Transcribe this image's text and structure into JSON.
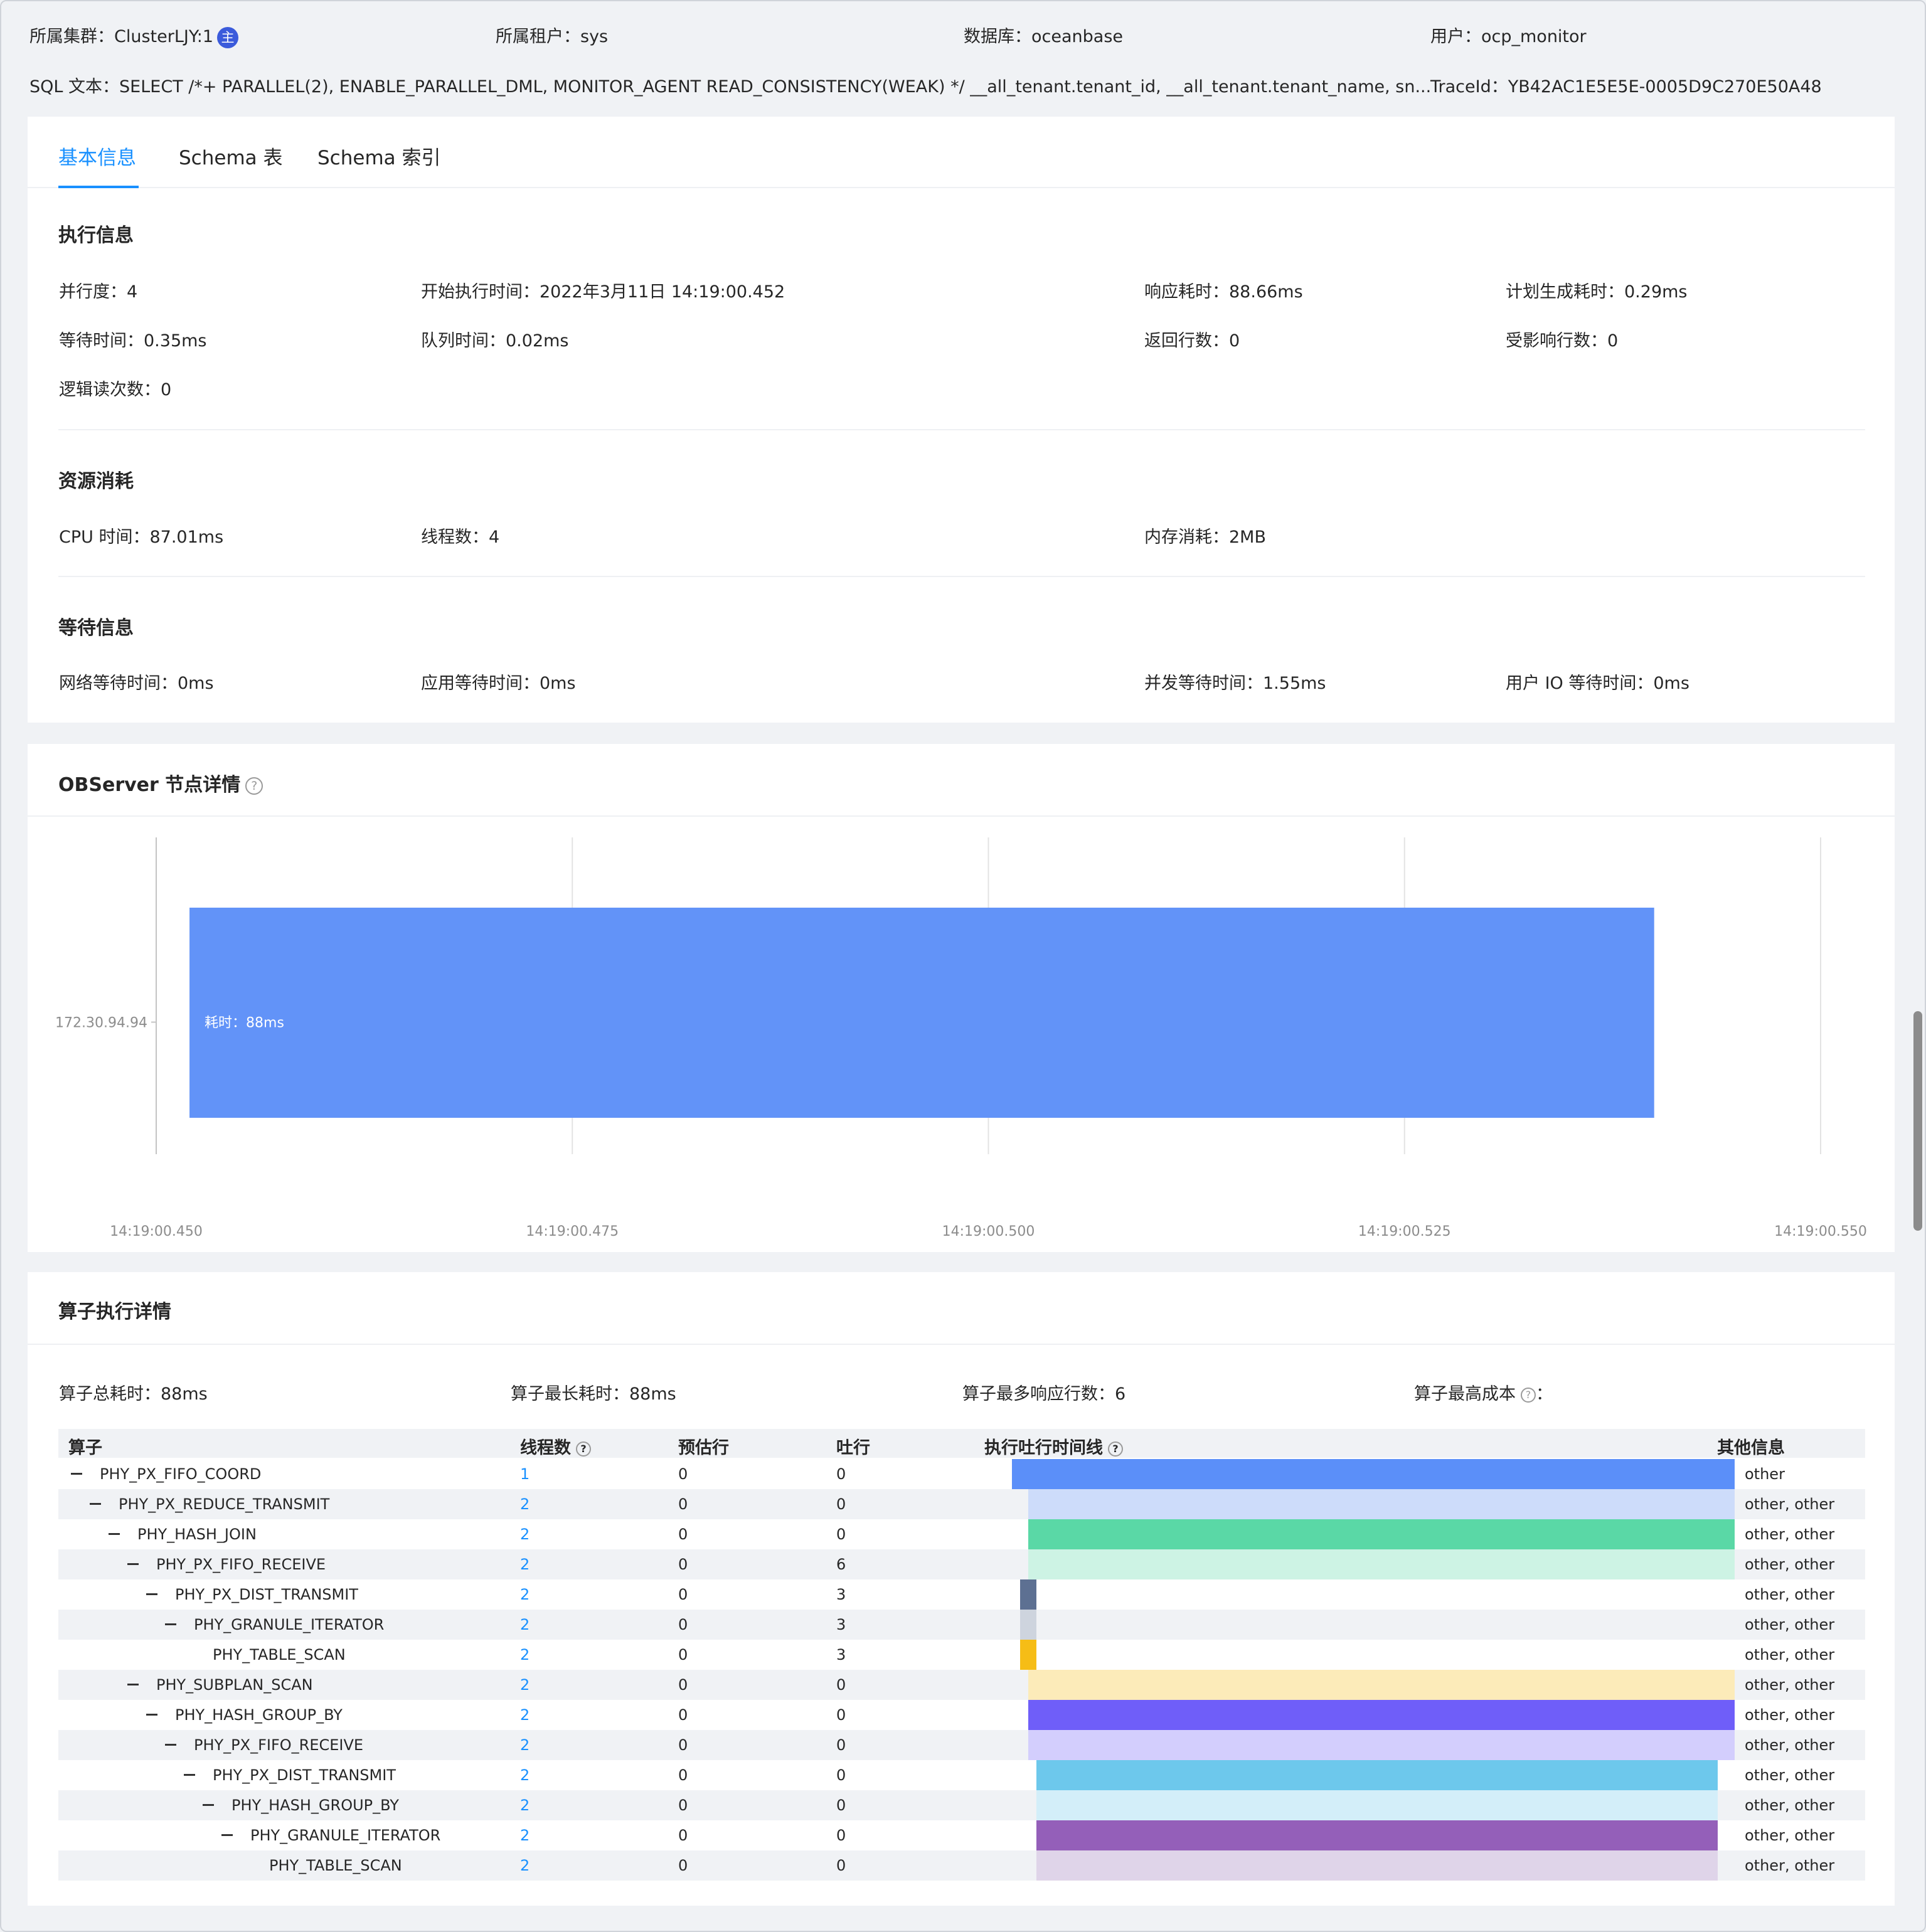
{
  "header": {
    "cluster_label": "所属集群：ClusterLJY:1",
    "cluster_badge": "主",
    "tenant_label": "所属租户：sys",
    "database_label": "数据库：oceanbase",
    "user_label": "用户：ocp_monitor",
    "sql_text_label": "SQL 文本：SELECT /*+ PARALLEL(2), ENABLE_PARALLEL_DML, MONITOR_AGENT READ_CONSISTENCY(WEAK) */ __all_tenant.tenant_id, __all_tenant.tenant_name, sn...",
    "trace_label": "TraceId：YB42AC1E5E5E-0005D9C270E50A48"
  },
  "tabs": [
    {
      "label": "基本信息",
      "active": true
    },
    {
      "label": "Schema 表",
      "active": false
    },
    {
      "label": "Schema 索引",
      "active": false
    }
  ],
  "exec_info": {
    "title": "执行信息",
    "items": [
      "并行度：4",
      "开始执行时间：2022年3月11日 14:19:00.452",
      "响应耗时：88.66ms",
      "计划生成耗时：0.29ms",
      "等待时间：0.35ms",
      "队列时间：0.02ms",
      "返回行数：0",
      "受影响行数：0",
      "逻辑读次数：0"
    ]
  },
  "resource": {
    "title": "资源消耗",
    "items": [
      "CPU 时间：87.01ms",
      "线程数：4",
      "内存消耗：2MB"
    ]
  },
  "wait": {
    "title": "等待信息",
    "items": [
      "网络等待时间：0ms",
      "应用等待时间：0ms",
      "并发等待时间：1.55ms",
      "用户 IO 等待时间：0ms"
    ]
  },
  "observer": {
    "title": "OBServer 节点详情",
    "help_icon": "?"
  },
  "chart_data": {
    "type": "bar",
    "orientation": "horizontal-gantt",
    "categories": [
      "172.30.94.94"
    ],
    "x_ticks": [
      "14:19:00.450",
      "14:19:00.475",
      "14:19:00.500",
      "14:19:00.525",
      "14:19:00.550"
    ],
    "xlim": [
      "14:19:00.450",
      "14:19:00.550"
    ],
    "series": [
      {
        "start": "14:19:00.452",
        "end": "14:19:00.540",
        "label": "耗时：88ms",
        "color": "#6293f8"
      }
    ],
    "grid": true
  },
  "operators": {
    "title": "算子执行详情",
    "summary": [
      "算子总耗时：88ms",
      "算子最长耗时：88ms",
      "算子最多响应行数：6",
      "算子最高成本"
    ],
    "summary_suffix": "：",
    "columns": [
      "算子",
      "线程数",
      "预估行",
      "吐行",
      "执行吐行时间线",
      "其他信息"
    ],
    "rows": [
      {
        "name": "PHY_PX_FIFO_COORD",
        "depth": 0,
        "toggle": true,
        "threads": "1",
        "est": "0",
        "out": "0",
        "bar_start": 0.0,
        "bar_end": 1.0,
        "color": "#5b8ff9",
        "other": "other"
      },
      {
        "name": "PHY_PX_REDUCE_TRANSMIT",
        "depth": 1,
        "toggle": true,
        "threads": "2",
        "est": "0",
        "out": "0",
        "bar_start": 0.023,
        "bar_end": 1.0,
        "color": "#cddcfa",
        "other": "other, other"
      },
      {
        "name": "PHY_HASH_JOIN",
        "depth": 2,
        "toggle": true,
        "threads": "2",
        "est": "0",
        "out": "0",
        "bar_start": 0.023,
        "bar_end": 1.0,
        "color": "#5ad8a6",
        "other": "other, other"
      },
      {
        "name": "PHY_PX_FIFO_RECEIVE",
        "depth": 3,
        "toggle": true,
        "threads": "2",
        "est": "0",
        "out": "6",
        "bar_start": 0.023,
        "bar_end": 1.0,
        "color": "#cdf3e4",
        "other": "other, other"
      },
      {
        "name": "PHY_PX_DIST_TRANSMIT",
        "depth": 4,
        "toggle": true,
        "threads": "2",
        "est": "0",
        "out": "3",
        "bar_start": 0.011,
        "bar_end": 0.034,
        "color": "#5d7092",
        "other": "other, other"
      },
      {
        "name": "PHY_GRANULE_ITERATOR",
        "depth": 5,
        "toggle": true,
        "threads": "2",
        "est": "0",
        "out": "3",
        "bar_start": 0.011,
        "bar_end": 0.034,
        "color": "#ced4de",
        "other": "other, other"
      },
      {
        "name": "PHY_TABLE_SCAN",
        "depth": 6,
        "toggle": false,
        "threads": "2",
        "est": "0",
        "out": "3",
        "bar_start": 0.011,
        "bar_end": 0.034,
        "color": "#f6bd16",
        "other": "other, other"
      },
      {
        "name": "PHY_SUBPLAN_SCAN",
        "depth": 3,
        "toggle": true,
        "threads": "2",
        "est": "0",
        "out": "0",
        "bar_start": 0.023,
        "bar_end": 1.0,
        "color": "#fcebb9",
        "other": "other, other"
      },
      {
        "name": "PHY_HASH_GROUP_BY",
        "depth": 4,
        "toggle": true,
        "threads": "2",
        "est": "0",
        "out": "0",
        "bar_start": 0.023,
        "bar_end": 1.0,
        "color": "#6f5ef9",
        "other": "other, other"
      },
      {
        "name": "PHY_PX_FIFO_RECEIVE",
        "depth": 5,
        "toggle": true,
        "threads": "2",
        "est": "0",
        "out": "0",
        "bar_start": 0.023,
        "bar_end": 1.0,
        "color": "#d3cefd",
        "other": "other, other"
      },
      {
        "name": "PHY_PX_DIST_TRANSMIT",
        "depth": 6,
        "toggle": true,
        "threads": "2",
        "est": "0",
        "out": "0",
        "bar_start": 0.034,
        "bar_end": 0.977,
        "color": "#6dc8ec",
        "other": "other, other"
      },
      {
        "name": "PHY_HASH_GROUP_BY",
        "depth": 7,
        "toggle": true,
        "threads": "2",
        "est": "0",
        "out": "0",
        "bar_start": 0.034,
        "bar_end": 0.977,
        "color": "#d3eef9",
        "other": "other, other"
      },
      {
        "name": "PHY_GRANULE_ITERATOR",
        "depth": 8,
        "toggle": true,
        "threads": "2",
        "est": "0",
        "out": "0",
        "bar_start": 0.034,
        "bar_end": 0.977,
        "color": "#945fb9",
        "other": "other, other"
      },
      {
        "name": "PHY_TABLE_SCAN",
        "depth": 9,
        "toggle": false,
        "threads": "2",
        "est": "0",
        "out": "0",
        "bar_start": 0.034,
        "bar_end": 0.977,
        "color": "#dfd4e9",
        "other": "other, other"
      }
    ]
  }
}
